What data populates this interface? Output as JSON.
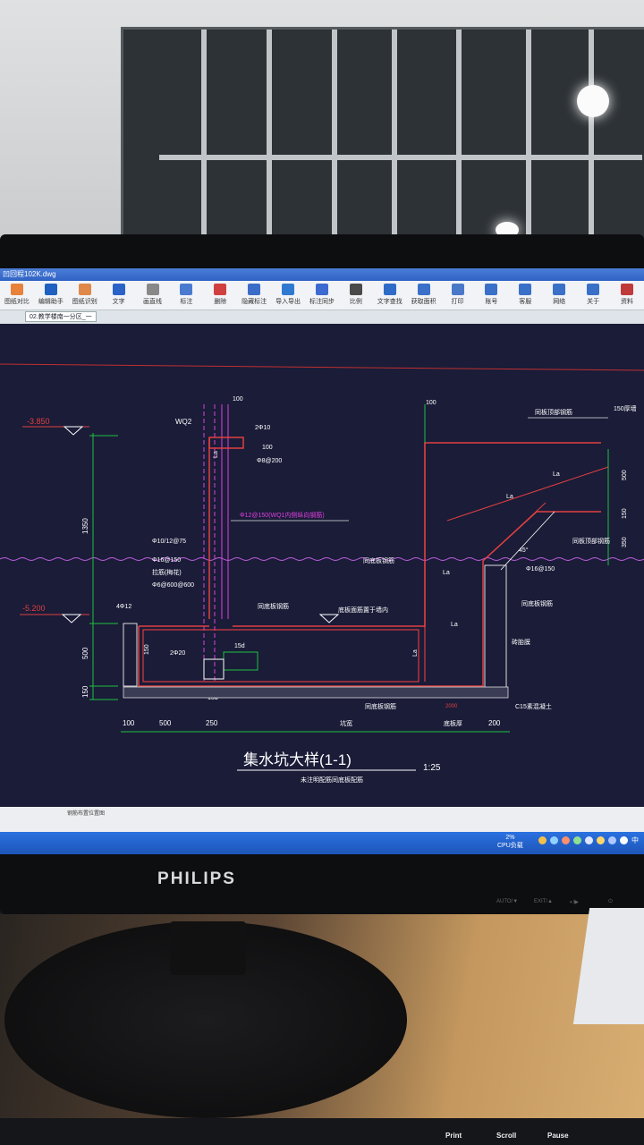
{
  "window_title": "凹回程102K.dwg",
  "toolbar": [
    {
      "label": "图纸对比",
      "icon": "compare-icon",
      "color": "#e8813a"
    },
    {
      "label": "编辑助手",
      "icon": "edit-assistant-icon",
      "color": "#2060c0"
    },
    {
      "label": "图纸识别",
      "icon": "recognize-icon",
      "color": "#e0884a"
    },
    {
      "label": "文字",
      "icon": "text-icon",
      "color": "#2a62c8"
    },
    {
      "label": "画直线",
      "icon": "line-icon",
      "color": "#888888"
    },
    {
      "label": "标注",
      "icon": "dimension-icon",
      "color": "#4a7ad0"
    },
    {
      "label": "删除",
      "icon": "eraser-icon",
      "color": "#d04040"
    },
    {
      "label": "隐藏标注",
      "icon": "hide-icon",
      "color": "#3b6cc8"
    },
    {
      "label": "导入导出",
      "icon": "import-export-icon",
      "color": "#2f7ad0"
    },
    {
      "label": "标注同步",
      "icon": "sync-icon",
      "color": "#3d6ad0"
    },
    {
      "label": "比例",
      "icon": "scale-icon",
      "color": "#4a4a4a"
    },
    {
      "label": "文字查找",
      "icon": "find-text-icon",
      "color": "#2f6cc8"
    },
    {
      "label": "获取面积",
      "icon": "area-icon",
      "color": "#3a70c8"
    },
    {
      "label": "打印",
      "icon": "print-icon",
      "color": "#4a78c8"
    },
    {
      "label": "账号",
      "icon": "account-icon",
      "color": "#3a70c8"
    },
    {
      "label": "客服",
      "icon": "service-icon",
      "color": "#3a70c8"
    },
    {
      "label": "网络",
      "icon": "network-icon",
      "color": "#3a70c8"
    },
    {
      "label": "关于",
      "icon": "about-icon",
      "color": "#3a70c8"
    },
    {
      "label": "资料",
      "icon": "docs-icon",
      "color": "#c03a3a"
    }
  ],
  "tabs": [
    "02.教学楼南一分区_一"
  ],
  "drawing": {
    "title": "集水坑大样(1-1)",
    "scale": "1:25",
    "subtitle": "未注明配筋同底板配筋",
    "elev_top": "-3.850",
    "elev_bottom": "-5.200",
    "dim_1350": "1350",
    "dim_500": "500",
    "dim_150": "150",
    "dim_100_top": "100",
    "dim_100_right": "100",
    "wq2": "WQ2",
    "rebar_2_10": "2Φ10",
    "dim_100b": "100",
    "rebar_8_200": "Φ8@200",
    "rebar_12_150": "Φ12@150(WQ1内侧纵向钢筋)",
    "rebar_10_12_75": "Φ10/12@75",
    "rebar_16_150_left": "Φ16@150",
    "stirrup": "拉筋(梅花)",
    "stirrup_spec": "Φ6@600@600",
    "rebar_4_12": "4Φ12",
    "rebar_2_20": "2Φ20",
    "dim_15d": "15d",
    "dim_15d_b": "15d",
    "dim_150_v": "150",
    "label_la": "La",
    "label_top_bar": "同板顶部钢筋",
    "label_150_thick": "150厚墙",
    "label_wall_bar": "同板顶部钢筋",
    "label_side": "同底板钢筋",
    "dim_r500": "500",
    "dim_r150": "150",
    "dim_r350": "350",
    "rebar_16_150_right": "Φ16@150",
    "label_inner_bar": "同底板钢筋",
    "label_pit_bar": "底板面筋置于墙内",
    "label_bottom_bar": "同底板钢筋",
    "label_brick": "砖胎膜",
    "label_bottom_bar2": "同底板钢筋",
    "c15": "C15素混凝土",
    "dim_b100": "100",
    "dim_b500": "500",
    "dim_b250": "250",
    "dim_pit": "坑宽",
    "dim_bottom": "底板厚",
    "dim_b200": "200",
    "dim_2000": "2000",
    "label_45": "45°",
    "status_text": "钢筋布置位置图"
  },
  "taskbar": {
    "cpu_percent": "2%",
    "cpu_label": "CPU负载",
    "ime": "中"
  },
  "monitor_brand": "PHILIPS",
  "monitor_controls": [
    "AUTO/▼",
    "EXIT/▲",
    "◐/▶",
    "⏻"
  ],
  "keys": [
    "Print",
    "Scroll",
    "Pause"
  ]
}
